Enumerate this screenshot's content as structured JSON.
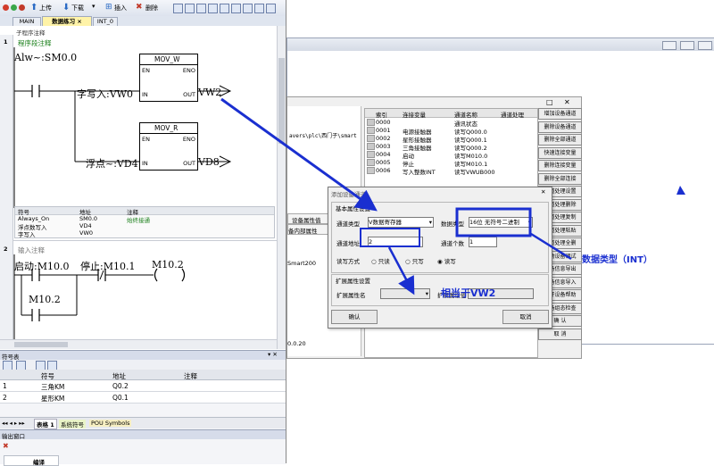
{
  "toolbar": {
    "upload": "上传",
    "download": "下载",
    "insert": "插入",
    "delete": "删除"
  },
  "tabs": [
    {
      "label": "MAIN"
    },
    {
      "label": "数据练习"
    },
    {
      "label": "INT_0"
    }
  ],
  "editor": {
    "subroutine_comment": "子程序注释",
    "network1": {
      "number": "1",
      "comment": "程序段注释",
      "contact": "Alw~:SM0.0",
      "block1": {
        "name": "MOV_W",
        "en": "EN",
        "eno": "ENO",
        "in": "IN",
        "out": "OUT",
        "in_value": "字写入:VW0",
        "out_value": "VW2"
      },
      "block2": {
        "name": "MOV_R",
        "en": "EN",
        "eno": "ENO",
        "in": "IN",
        "out": "OUT",
        "in_value": "浮点~:VD4",
        "out_value": "VD8"
      }
    },
    "symbols": {
      "headers": [
        "符号",
        "地址",
        "注释"
      ],
      "rows": [
        [
          "Always_On",
          "SM0.0",
          "始终接通"
        ],
        [
          "浮点数写入",
          "VD4",
          ""
        ],
        [
          "字写入",
          "VW0",
          ""
        ]
      ]
    },
    "network2": {
      "number": "2",
      "comment": "输入注释",
      "c1": "启动:M10.0",
      "c2": "停止:M10.1",
      "coil": "M10.2",
      "c3": "M10.2"
    }
  },
  "symbol_table": {
    "title": "符号表",
    "headers": [
      "符号",
      "地址",
      "注释"
    ],
    "rows": [
      {
        "num": "1",
        "symbol": "三角KM",
        "address": "Q0.2",
        "comment": ""
      },
      {
        "num": "2",
        "symbol": "星形KM",
        "address": "Q0.1",
        "comment": ""
      }
    ],
    "tabs": [
      "表格 1",
      "系统符号",
      "POU Symbols"
    ]
  },
  "output_window": {
    "title": "输出窗口",
    "build_label": "编译"
  },
  "config_window": {
    "path_text": "avers\\plc\\西门子\\smart",
    "side_tabs": [
      "设备属性值",
      "备内部属性"
    ],
    "side_value": "Smart200",
    "bottom_value": "0.0.20",
    "table": {
      "headers": [
        "索引",
        "连接变量",
        "通道名称",
        "通道处理"
      ],
      "rows": [
        [
          "0000",
          "",
          "通讯状态",
          ""
        ],
        [
          "0001",
          "电源接触器",
          "读写Q000.0",
          ""
        ],
        [
          "0002",
          "星形接触器",
          "读写Q000.1",
          ""
        ],
        [
          "0003",
          "三角接触器",
          "读写Q000.2",
          ""
        ],
        [
          "0004",
          "启动",
          "读写M010.0",
          ""
        ],
        [
          "0005",
          "停止",
          "读写M010.1",
          ""
        ],
        [
          "0006",
          "写入整数INT",
          "读写VWUB000",
          ""
        ]
      ]
    },
    "buttons": [
      "增加设备通道",
      "删除设备通道",
      "删除全部通道",
      "快速连接变量",
      "删除连接变量",
      "删除全部连接",
      "通道处理设置",
      "通道处理删除",
      "通道处理复制",
      "通道处理粘贴",
      "通道处理全删",
      "启动设备调试",
      "设备信息导出",
      "设备信息导入",
      "打开设备帮助",
      "设备组态检查",
      "确  认",
      "取  消"
    ]
  },
  "dialog": {
    "title": "添加设备通道",
    "basic_group": "基本属性设置",
    "channel_type_label": "通道类型",
    "channel_type_value": "V数据寄存器",
    "data_type_label": "数据类型",
    "data_type_value": "16位 无符号二进制",
    "channel_addr_label": "通道地址",
    "channel_addr_value": "2",
    "channel_count_label": "通道个数",
    "channel_count_value": "1",
    "rw_label": "读写方式",
    "rw_options": [
      "只读",
      "只写",
      "读写"
    ],
    "ext_group": "扩展属性设置",
    "ext_name_label": "扩展属性名",
    "ext_value_label": "扩展属性值",
    "ok": "确认",
    "cancel": "取消"
  },
  "annotations": {
    "equal": "相当于VW2",
    "data_type": "数据类型（INT）"
  }
}
